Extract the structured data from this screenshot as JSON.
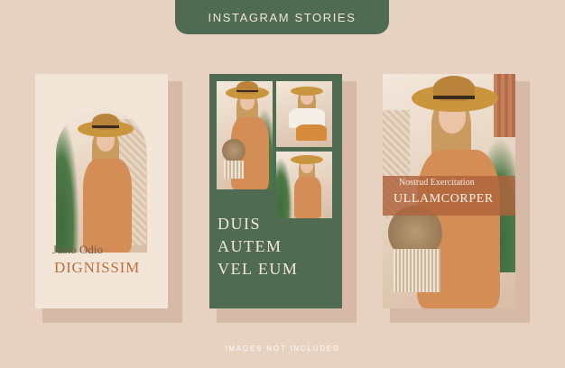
{
  "header": {
    "title": "INSTAGRAM STORIES"
  },
  "story1": {
    "script_text": "Justo Odio",
    "headline": "DIGNISSIM"
  },
  "story2": {
    "line1": "DUIS",
    "line2": "AUTEM",
    "line3": "VEL EUM"
  },
  "story3": {
    "script_text": "Nostrud Exercitation",
    "headline": "ULLAMCORPER"
  },
  "footer": {
    "note": "IMAGES NOT INCLUDED"
  },
  "colors": {
    "background": "#e7d1c1",
    "green": "#4f6b52",
    "cream": "#f3e6d9",
    "terracotta": "#c0703f",
    "shadow": "#d6b9a7"
  }
}
